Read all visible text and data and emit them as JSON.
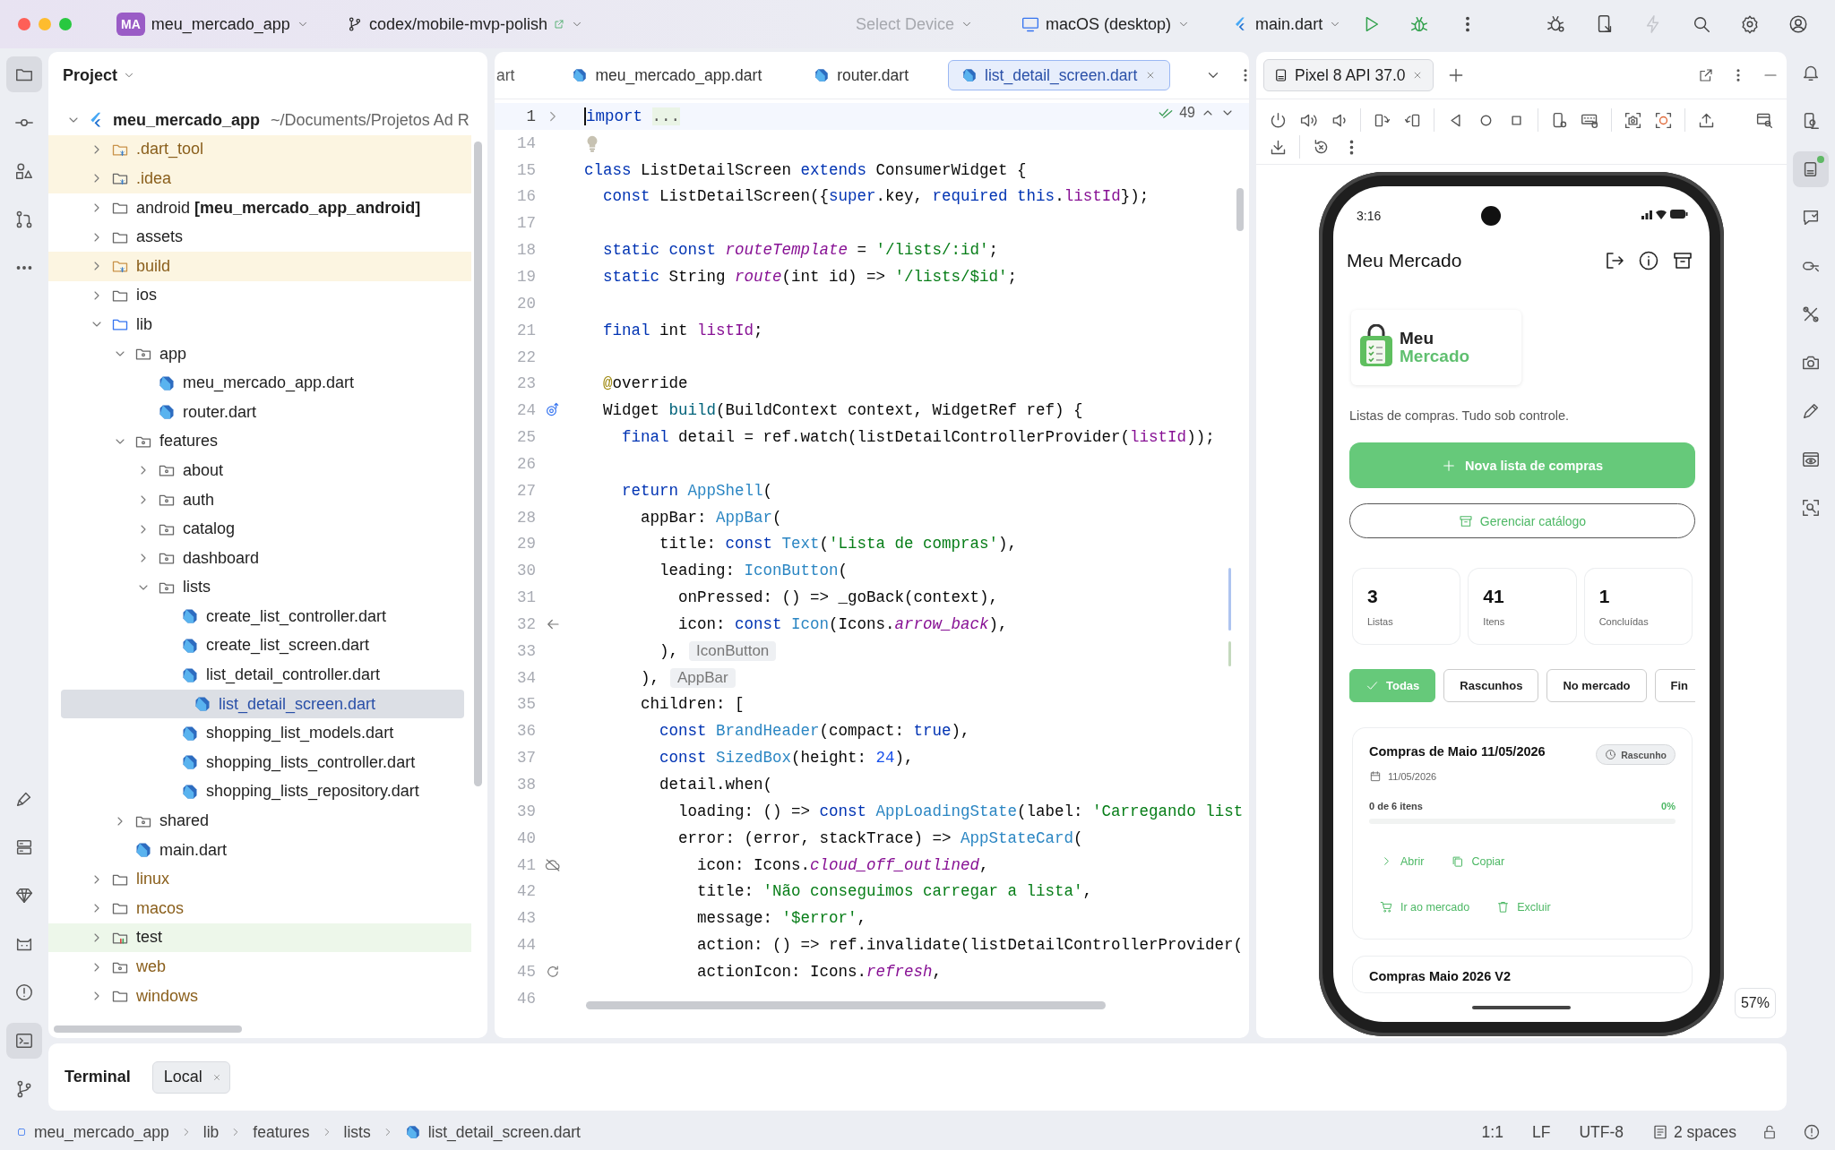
{
  "titlebar": {
    "project": {
      "badge": "MA",
      "name": "meu_mercado_app"
    },
    "branch": "codex/mobile-mvp-polish",
    "device_selector": {
      "label": "Select Device",
      "disabled": true
    },
    "target": "macOS (desktop)",
    "run_config": "main.dart",
    "actions": [
      {
        "kind": "run"
      },
      {
        "kind": "debug"
      },
      {
        "kind": "more"
      }
    ],
    "tools": [
      {
        "kind": "bugsettings",
        "disabled": false
      },
      {
        "kind": "devicemirror",
        "disabled": false
      },
      {
        "kind": "lightning",
        "disabled": true
      },
      {
        "kind": "search",
        "disabled": false
      },
      {
        "kind": "settings",
        "disabled": false
      },
      {
        "kind": "account",
        "disabled": false
      }
    ]
  },
  "left_toolbar": {
    "top": [
      {
        "kind": "folder",
        "selected": true
      },
      {
        "kind": "commit",
        "selected": false
      },
      {
        "kind": "structure",
        "selected": false
      },
      {
        "kind": "pullrequests",
        "selected": false
      },
      {
        "kind": "more",
        "selected": false
      }
    ],
    "bottom": [
      {
        "kind": "brush",
        "selected": false
      },
      {
        "kind": "services",
        "selected": false
      },
      {
        "kind": "diamond",
        "selected": false
      },
      {
        "kind": "robot",
        "selected": false
      },
      {
        "kind": "problems",
        "selected": false
      },
      {
        "kind": "terminal",
        "selected": true
      },
      {
        "kind": "git",
        "selected": false
      }
    ]
  },
  "project": {
    "title": "Project",
    "root": {
      "name": "meu_mercado_app",
      "path": "~/Documents/Projetos Ad R",
      "expanded": true,
      "children": [
        {
          "label": ".dart_tool",
          "kind": "excluded",
          "expanded": false,
          "selected": false
        },
        {
          "label": ".idea",
          "kind": "config",
          "expanded": false,
          "selected": false
        },
        {
          "label": "android **[meu_mercado_app_android]**",
          "kind": "folder",
          "expanded": false,
          "selected": false
        },
        {
          "label": "assets",
          "kind": "folder",
          "expanded": false,
          "selected": false
        },
        {
          "label": "build",
          "kind": "excluded",
          "expanded": false,
          "selected": false
        },
        {
          "label": "ios",
          "kind": "folder",
          "expanded": false,
          "selected": false
        },
        {
          "label": "lib",
          "kind": "source",
          "expanded": true,
          "selected": false,
          "children": [
            {
              "label": "app",
              "kind": "package",
              "expanded": true,
              "selected": false,
              "children": [
                {
                  "label": "meu_mercado_app.dart",
                  "kind": "dart",
                  "selected": false
                },
                {
                  "label": "router.dart",
                  "kind": "dart",
                  "selected": false
                }
              ]
            },
            {
              "label": "features",
              "kind": "package",
              "expanded": true,
              "selected": false,
              "children": [
                {
                  "label": "about",
                  "kind": "package",
                  "expanded": false,
                  "selected": false
                },
                {
                  "label": "auth",
                  "kind": "package",
                  "expanded": false,
                  "selected": false
                },
                {
                  "label": "catalog",
                  "kind": "package",
                  "expanded": false,
                  "selected": false
                },
                {
                  "label": "dashboard",
                  "kind": "package",
                  "expanded": false,
                  "selected": false
                },
                {
                  "label": "lists",
                  "kind": "package",
                  "expanded": true,
                  "selected": false,
                  "children": [
                    {
                      "label": "create_list_controller.dart",
                      "kind": "dart",
                      "selected": false
                    },
                    {
                      "label": "create_list_screen.dart",
                      "kind": "dart",
                      "selected": false
                    },
                    {
                      "label": "list_detail_controller.dart",
                      "kind": "dart",
                      "selected": false
                    },
                    {
                      "label": "list_detail_screen.dart",
                      "kind": "dart",
                      "selected": true
                    },
                    {
                      "label": "shopping_list_models.dart",
                      "kind": "dart",
                      "selected": false
                    },
                    {
                      "label": "shopping_lists_controller.dart",
                      "kind": "dart",
                      "selected": false
                    },
                    {
                      "label": "shopping_lists_repository.dart",
                      "kind": "dart",
                      "selected": false
                    }
                  ]
                }
              ]
            },
            {
              "label": "shared",
              "kind": "package",
              "expanded": false,
              "selected": false
            },
            {
              "label": "main.dart",
              "kind": "dart",
              "selected": false
            }
          ]
        },
        {
          "label": "linux",
          "kind": "platform",
          "expanded": false,
          "selected": false
        },
        {
          "label": "macos",
          "kind": "platform",
          "expanded": false,
          "selected": false
        },
        {
          "label": "test",
          "kind": "test",
          "expanded": false,
          "selected": false
        },
        {
          "label": "web",
          "kind": "web",
          "expanded": false,
          "selected": false
        },
        {
          "label": "windows",
          "kind": "platform",
          "expanded": false,
          "selected": false
        }
      ]
    }
  },
  "editor": {
    "tabs": [
      {
        "label": "art",
        "clipped": true,
        "selected": false
      },
      {
        "label": "meu_mercado_app.dart",
        "clipped": false,
        "selected": false
      },
      {
        "label": "router.dart",
        "clipped": false,
        "selected": false
      },
      {
        "label": "list_detail_screen.dart",
        "clipped": false,
        "selected": true
      }
    ],
    "inspections": "49",
    "lines": [
      {
        "number": "1",
        "current": true,
        "kind": "fold",
        "code": [
          {
            "kind": "keyword",
            "text": "import "
          },
          {
            "kind": "fold",
            "text": "..."
          }
        ]
      },
      {
        "number": "14",
        "current": false,
        "kind": "bulb"
      },
      {
        "number": "15",
        "current": false,
        "code": [
          {
            "kind": "keyword",
            "text": "class"
          },
          {
            "kind": "plain",
            "text": " ListDetailScreen "
          },
          {
            "kind": "keyword",
            "text": "extends"
          },
          {
            "kind": "plain",
            "text": " ConsumerWidget {"
          }
        ]
      },
      {
        "number": "16",
        "current": false,
        "code": [
          {
            "kind": "keyword",
            "text": "  const"
          },
          {
            "kind": "plain",
            "text": " ListDetailScreen({"
          },
          {
            "kind": "keyword",
            "text": "super"
          },
          {
            "kind": "plain",
            "text": ".key, "
          },
          {
            "kind": "keyword",
            "text": "required this"
          },
          {
            "kind": "plain",
            "text": "."
          },
          {
            "kind": "param",
            "text": "listId"
          },
          {
            "kind": "plain",
            "text": "});"
          }
        ]
      },
      {
        "number": "17",
        "current": false
      },
      {
        "number": "18",
        "current": false,
        "code": [
          {
            "kind": "keyword",
            "text": "  static const "
          },
          {
            "kind": "field",
            "text": "routeTemplate"
          },
          {
            "kind": "plain",
            "text": " = "
          },
          {
            "kind": "string",
            "text": "'/lists/:id'"
          },
          {
            "kind": "plain",
            "text": ";"
          }
        ]
      },
      {
        "number": "19",
        "current": false,
        "code": [
          {
            "kind": "keyword",
            "text": "  static"
          },
          {
            "kind": "plain",
            "text": " String "
          },
          {
            "kind": "field",
            "text": "route"
          },
          {
            "kind": "plain",
            "text": "(int id) => "
          },
          {
            "kind": "string",
            "text": "'/lists/$id'"
          },
          {
            "kind": "plain",
            "text": ";"
          }
        ]
      },
      {
        "number": "20",
        "current": false
      },
      {
        "number": "21",
        "current": false,
        "code": [
          {
            "kind": "keyword",
            "text": "  final"
          },
          {
            "kind": "plain",
            "text": " int "
          },
          {
            "kind": "param",
            "text": "listId"
          },
          {
            "kind": "plain",
            "text": ";"
          }
        ]
      },
      {
        "number": "22",
        "current": false
      },
      {
        "number": "23",
        "current": false,
        "code": [
          {
            "kind": "annotation",
            "text": "  @"
          },
          {
            "kind": "plain",
            "text": "override"
          }
        ]
      },
      {
        "number": "24",
        "current": false,
        "kind": "override",
        "code": [
          {
            "kind": "plain",
            "text": "  Widget "
          },
          {
            "kind": "method",
            "text": "build"
          },
          {
            "kind": "plain",
            "text": "(BuildContext context, WidgetRef ref) {"
          }
        ]
      },
      {
        "number": "25",
        "current": false,
        "code": [
          {
            "kind": "keyword",
            "text": "    final"
          },
          {
            "kind": "plain",
            "text": " detail = ref.watch(listDetailControllerProvider("
          },
          {
            "kind": "param",
            "text": "listId"
          },
          {
            "kind": "plain",
            "text": "));"
          }
        ]
      },
      {
        "number": "26",
        "current": false
      },
      {
        "number": "27",
        "current": false,
        "code": [
          {
            "kind": "keyword",
            "text": "    return "
          },
          {
            "kind": "class",
            "text": "AppShell"
          },
          {
            "kind": "plain",
            "text": "("
          }
        ]
      },
      {
        "number": "28",
        "current": false,
        "code": [
          {
            "kind": "plain",
            "text": "      appBar: "
          },
          {
            "kind": "class",
            "text": "AppBar"
          },
          {
            "kind": "plain",
            "text": "("
          }
        ]
      },
      {
        "number": "29",
        "current": false,
        "code": [
          {
            "kind": "plain",
            "text": "        title: "
          },
          {
            "kind": "keyword",
            "text": "const "
          },
          {
            "kind": "class",
            "text": "Text"
          },
          {
            "kind": "plain",
            "text": "("
          },
          {
            "kind": "string",
            "text": "'Lista de compras'"
          },
          {
            "kind": "plain",
            "text": "),"
          }
        ]
      },
      {
        "number": "30",
        "current": false,
        "code": [
          {
            "kind": "plain",
            "text": "        leading: "
          },
          {
            "kind": "class",
            "text": "IconButton"
          },
          {
            "kind": "plain",
            "text": "("
          }
        ]
      },
      {
        "number": "31",
        "current": false,
        "code": [
          {
            "kind": "plain",
            "text": "          onPressed: () => _goBack(context),"
          }
        ]
      },
      {
        "number": "32",
        "current": false,
        "kind": "back",
        "code": [
          {
            "kind": "plain",
            "text": "          icon: "
          },
          {
            "kind": "keyword",
            "text": "const "
          },
          {
            "kind": "class",
            "text": "Icon"
          },
          {
            "kind": "plain",
            "text": "(Icons."
          },
          {
            "kind": "field",
            "text": "arrow_back"
          },
          {
            "kind": "plain",
            "text": "),"
          }
        ]
      },
      {
        "number": "33",
        "current": false,
        "hint": "IconButton",
        "code": [
          {
            "kind": "plain",
            "text": "        ),"
          }
        ]
      },
      {
        "number": "34",
        "current": false,
        "hint": "AppBar",
        "code": [
          {
            "kind": "plain",
            "text": "      ),"
          }
        ]
      },
      {
        "number": "35",
        "current": false,
        "code": [
          {
            "kind": "plain",
            "text": "      children: ["
          }
        ]
      },
      {
        "number": "36",
        "current": false,
        "code": [
          {
            "kind": "keyword",
            "text": "        const "
          },
          {
            "kind": "class",
            "text": "BrandHeader"
          },
          {
            "kind": "plain",
            "text": "(compact: "
          },
          {
            "kind": "keyword",
            "text": "true"
          },
          {
            "kind": "plain",
            "text": "),"
          }
        ]
      },
      {
        "number": "37",
        "current": false,
        "code": [
          {
            "kind": "keyword",
            "text": "        const "
          },
          {
            "kind": "class",
            "text": "SizedBox"
          },
          {
            "kind": "plain",
            "text": "(height: "
          },
          {
            "kind": "number",
            "text": "24"
          },
          {
            "kind": "plain",
            "text": "),"
          }
        ]
      },
      {
        "number": "38",
        "current": false,
        "code": [
          {
            "kind": "plain",
            "text": "        detail.when("
          }
        ]
      },
      {
        "number": "39",
        "current": false,
        "code": [
          {
            "kind": "plain",
            "text": "          loading: () => "
          },
          {
            "kind": "keyword",
            "text": "const "
          },
          {
            "kind": "class",
            "text": "AppLoadingState"
          },
          {
            "kind": "plain",
            "text": "(label: "
          },
          {
            "kind": "string",
            "text": "'Carregando list"
          }
        ]
      },
      {
        "number": "40",
        "current": false,
        "code": [
          {
            "kind": "plain",
            "text": "          error: (error, stackTrace) => "
          },
          {
            "kind": "class",
            "text": "AppStateCard"
          },
          {
            "kind": "plain",
            "text": "("
          }
        ]
      },
      {
        "number": "41",
        "current": false,
        "kind": "cloudoff",
        "code": [
          {
            "kind": "plain",
            "text": "            icon: Icons."
          },
          {
            "kind": "field",
            "text": "cloud_off_outlined"
          },
          {
            "kind": "plain",
            "text": ","
          }
        ]
      },
      {
        "number": "42",
        "current": false,
        "code": [
          {
            "kind": "plain",
            "text": "            title: "
          },
          {
            "kind": "string",
            "text": "'Não conseguimos carregar a lista'"
          },
          {
            "kind": "plain",
            "text": ","
          }
        ]
      },
      {
        "number": "43",
        "current": false,
        "code": [
          {
            "kind": "plain",
            "text": "            message: "
          },
          {
            "kind": "string",
            "text": "'$error'"
          },
          {
            "kind": "plain",
            "text": ","
          }
        ]
      },
      {
        "number": "44",
        "current": false,
        "code": [
          {
            "kind": "plain",
            "text": "            action: () => ref.invalidate(listDetailControllerProvider("
          }
        ]
      },
      {
        "number": "45",
        "current": false,
        "kind": "refresh",
        "code": [
          {
            "kind": "plain",
            "text": "            actionIcon: Icons."
          },
          {
            "kind": "field",
            "text": "refresh"
          },
          {
            "kind": "plain",
            "text": ","
          }
        ]
      },
      {
        "number": "46",
        "current": false
      }
    ]
  },
  "running_devices": {
    "tab": {
      "label": "Pixel 8 API 37.0",
      "selected": true
    },
    "toolbar": [
      {
        "kind": "power"
      },
      {
        "kind": "volup"
      },
      {
        "kind": "voldown"
      },
      {
        "kind": "rotleft"
      },
      {
        "kind": "rotright"
      },
      {
        "kind": "back"
      },
      {
        "kind": "home"
      },
      {
        "kind": "overview"
      },
      {
        "kind": "devsettings"
      },
      {
        "kind": "keyboard"
      },
      {
        "kind": "screenshot"
      },
      {
        "kind": "record"
      },
      {
        "kind": "upload"
      },
      {
        "kind": "windowsearch"
      },
      {
        "kind": "download"
      },
      {
        "kind": "reset"
      },
      {
        "kind": "more"
      }
    ],
    "zoom": "57%",
    "phone": {
      "time": "3:16",
      "app_title": "Meu Mercado",
      "brand": {
        "line1": "Meu",
        "line2": "Mercado"
      },
      "tagline": "Listas de compras. Tudo sob controle.",
      "primary_action": "Nova lista de compras",
      "secondary_action": "Gerenciar catálogo",
      "stats": [
        {
          "value": "3",
          "label": "Listas"
        },
        {
          "value": "41",
          "label": "Itens"
        },
        {
          "value": "1",
          "label": "Concluídas"
        }
      ],
      "filters": [
        {
          "label": "Todas",
          "selected": true
        },
        {
          "label": "Rascunhos",
          "selected": false
        },
        {
          "label": "No mercado",
          "selected": false
        },
        {
          "label": "Fin",
          "selected": false
        }
      ],
      "lists": [
        {
          "title": "Compras de Maio 11/05/2026",
          "status": "Rascunho",
          "date": "11/05/2026",
          "count": "0 de 6 itens",
          "percent": "0%",
          "level": 0,
          "actions": [
            {
              "kind": "open",
              "label": "Abrir"
            },
            {
              "kind": "copy",
              "label": "Copiar"
            },
            {
              "kind": "market",
              "label": "Ir ao mercado"
            },
            {
              "kind": "delete",
              "label": "Excluir"
            }
          ]
        },
        {
          "title": "Compras Maio 2026 V2"
        }
      ]
    }
  },
  "right_toolbar": [
    {
      "kind": "bell",
      "selected": false
    },
    {
      "kind": "devicemanager",
      "selected": false
    },
    {
      "kind": "runningdevices",
      "selected": true
    },
    {
      "kind": "chat",
      "selected": false
    },
    {
      "kind": "link",
      "selected": false
    },
    {
      "kind": "tools",
      "selected": false
    },
    {
      "kind": "camera",
      "selected": false
    },
    {
      "kind": "pen",
      "selected": false
    },
    {
      "kind": "preview",
      "selected": false
    },
    {
      "kind": "inspect",
      "selected": false
    }
  ],
  "terminal": {
    "title": "Terminal",
    "tabs": [
      {
        "label": "Local",
        "selected": true
      }
    ]
  },
  "status_bar": {
    "breadcrumb": [
      "meu_mercado_app",
      "lib",
      "features",
      "lists",
      "list_detail_screen.dart"
    ],
    "position": "1:1",
    "line_separator": "LF",
    "encoding": "UTF-8",
    "indent": "2 spaces"
  }
}
